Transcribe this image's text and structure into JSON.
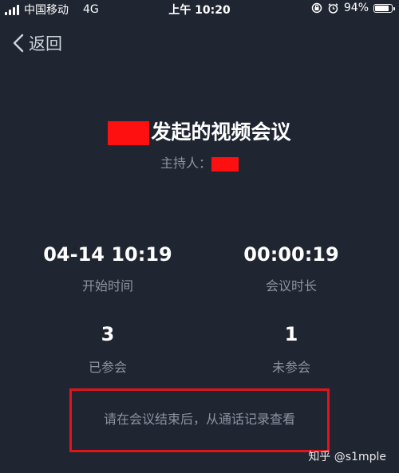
{
  "status_bar": {
    "carrier": "中国移动",
    "network": "4G",
    "time": "上午 10:20",
    "battery_text": "94%",
    "battery_level": 0.94
  },
  "nav": {
    "back_label": "返回"
  },
  "meeting": {
    "title_suffix": "发起的视频会议",
    "host_label": "主持人："
  },
  "stats": {
    "start_time_value": "04-14 10:19",
    "start_time_label": "开始时间",
    "duration_value": "00:00:19",
    "duration_label": "会议时长",
    "joined_value": "3",
    "joined_label": "已参会",
    "not_joined_value": "1",
    "not_joined_label": "未参会"
  },
  "notice": {
    "text": "请在会议结束后，从通话记录查看"
  },
  "watermark": {
    "text": "知乎 @s1mple"
  },
  "colors": {
    "background": "#1f2531",
    "label_gray": "#8d93a0",
    "highlight_red": "#e1141e",
    "redaction_red": "#ff1010"
  }
}
